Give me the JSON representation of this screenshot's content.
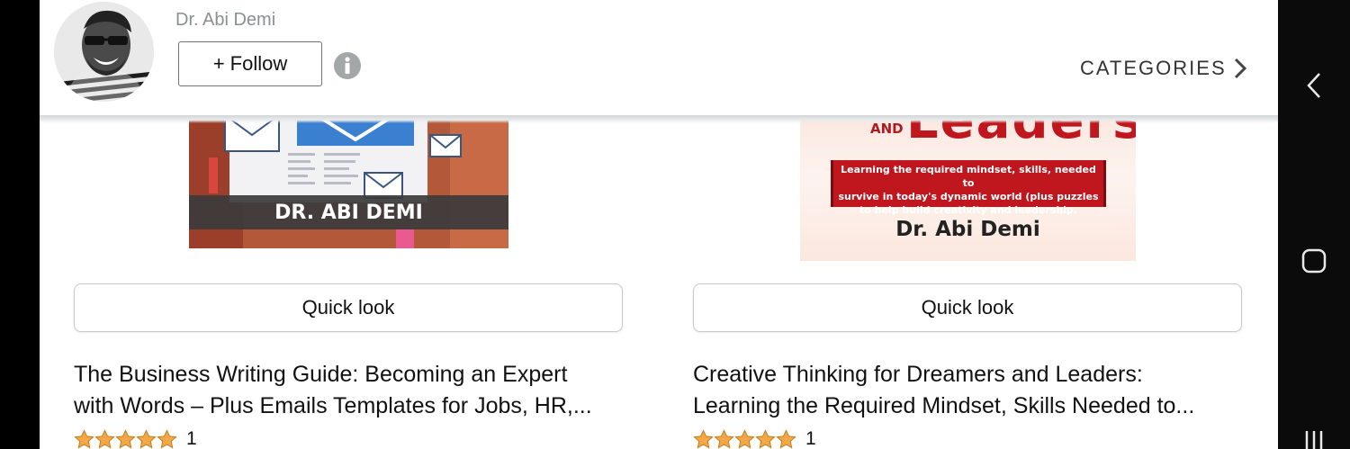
{
  "header": {
    "author_name": "Dr. Abi Demi",
    "follow_label": "+ Follow",
    "categories_label": "CATEGORIES"
  },
  "books": [
    {
      "cover_author_text": "DR. ABI DEMI",
      "quick_look_label": "Quick look",
      "title_line1": "The Business Writing Guide: Becoming an Expert",
      "title_line2": "with Words – Plus Emails Templates for Jobs, HR,...",
      "stars": 5,
      "rating_count": "1"
    },
    {
      "cover_title_fragment": "Leaders",
      "cover_and_text": "AND",
      "cover_subtitle_line1": "Learning the required mindset, skills, needed to",
      "cover_subtitle_line2": "survive in today's dynamic world (plus puzzles",
      "cover_subtitle_line3": "to help build creativity and leadership.",
      "cover_author_text": "Dr. Abi Demi",
      "quick_look_label": "Quick look",
      "title_line1": "Creative Thinking for Dreamers and Leaders:",
      "title_line2": "Learning the Required Mindset, Skills Needed to...",
      "stars": 5,
      "rating_count": "1"
    }
  ],
  "colors": {
    "star": "#f3a847",
    "cover2_red": "#c0161e",
    "cover1_band": "#3b3b3b"
  },
  "icons": {
    "info": "info-icon",
    "chevron": "chevron-right-icon",
    "nav_back": "nav-back-icon",
    "nav_home": "nav-home-icon",
    "nav_recent": "nav-recents-icon"
  }
}
